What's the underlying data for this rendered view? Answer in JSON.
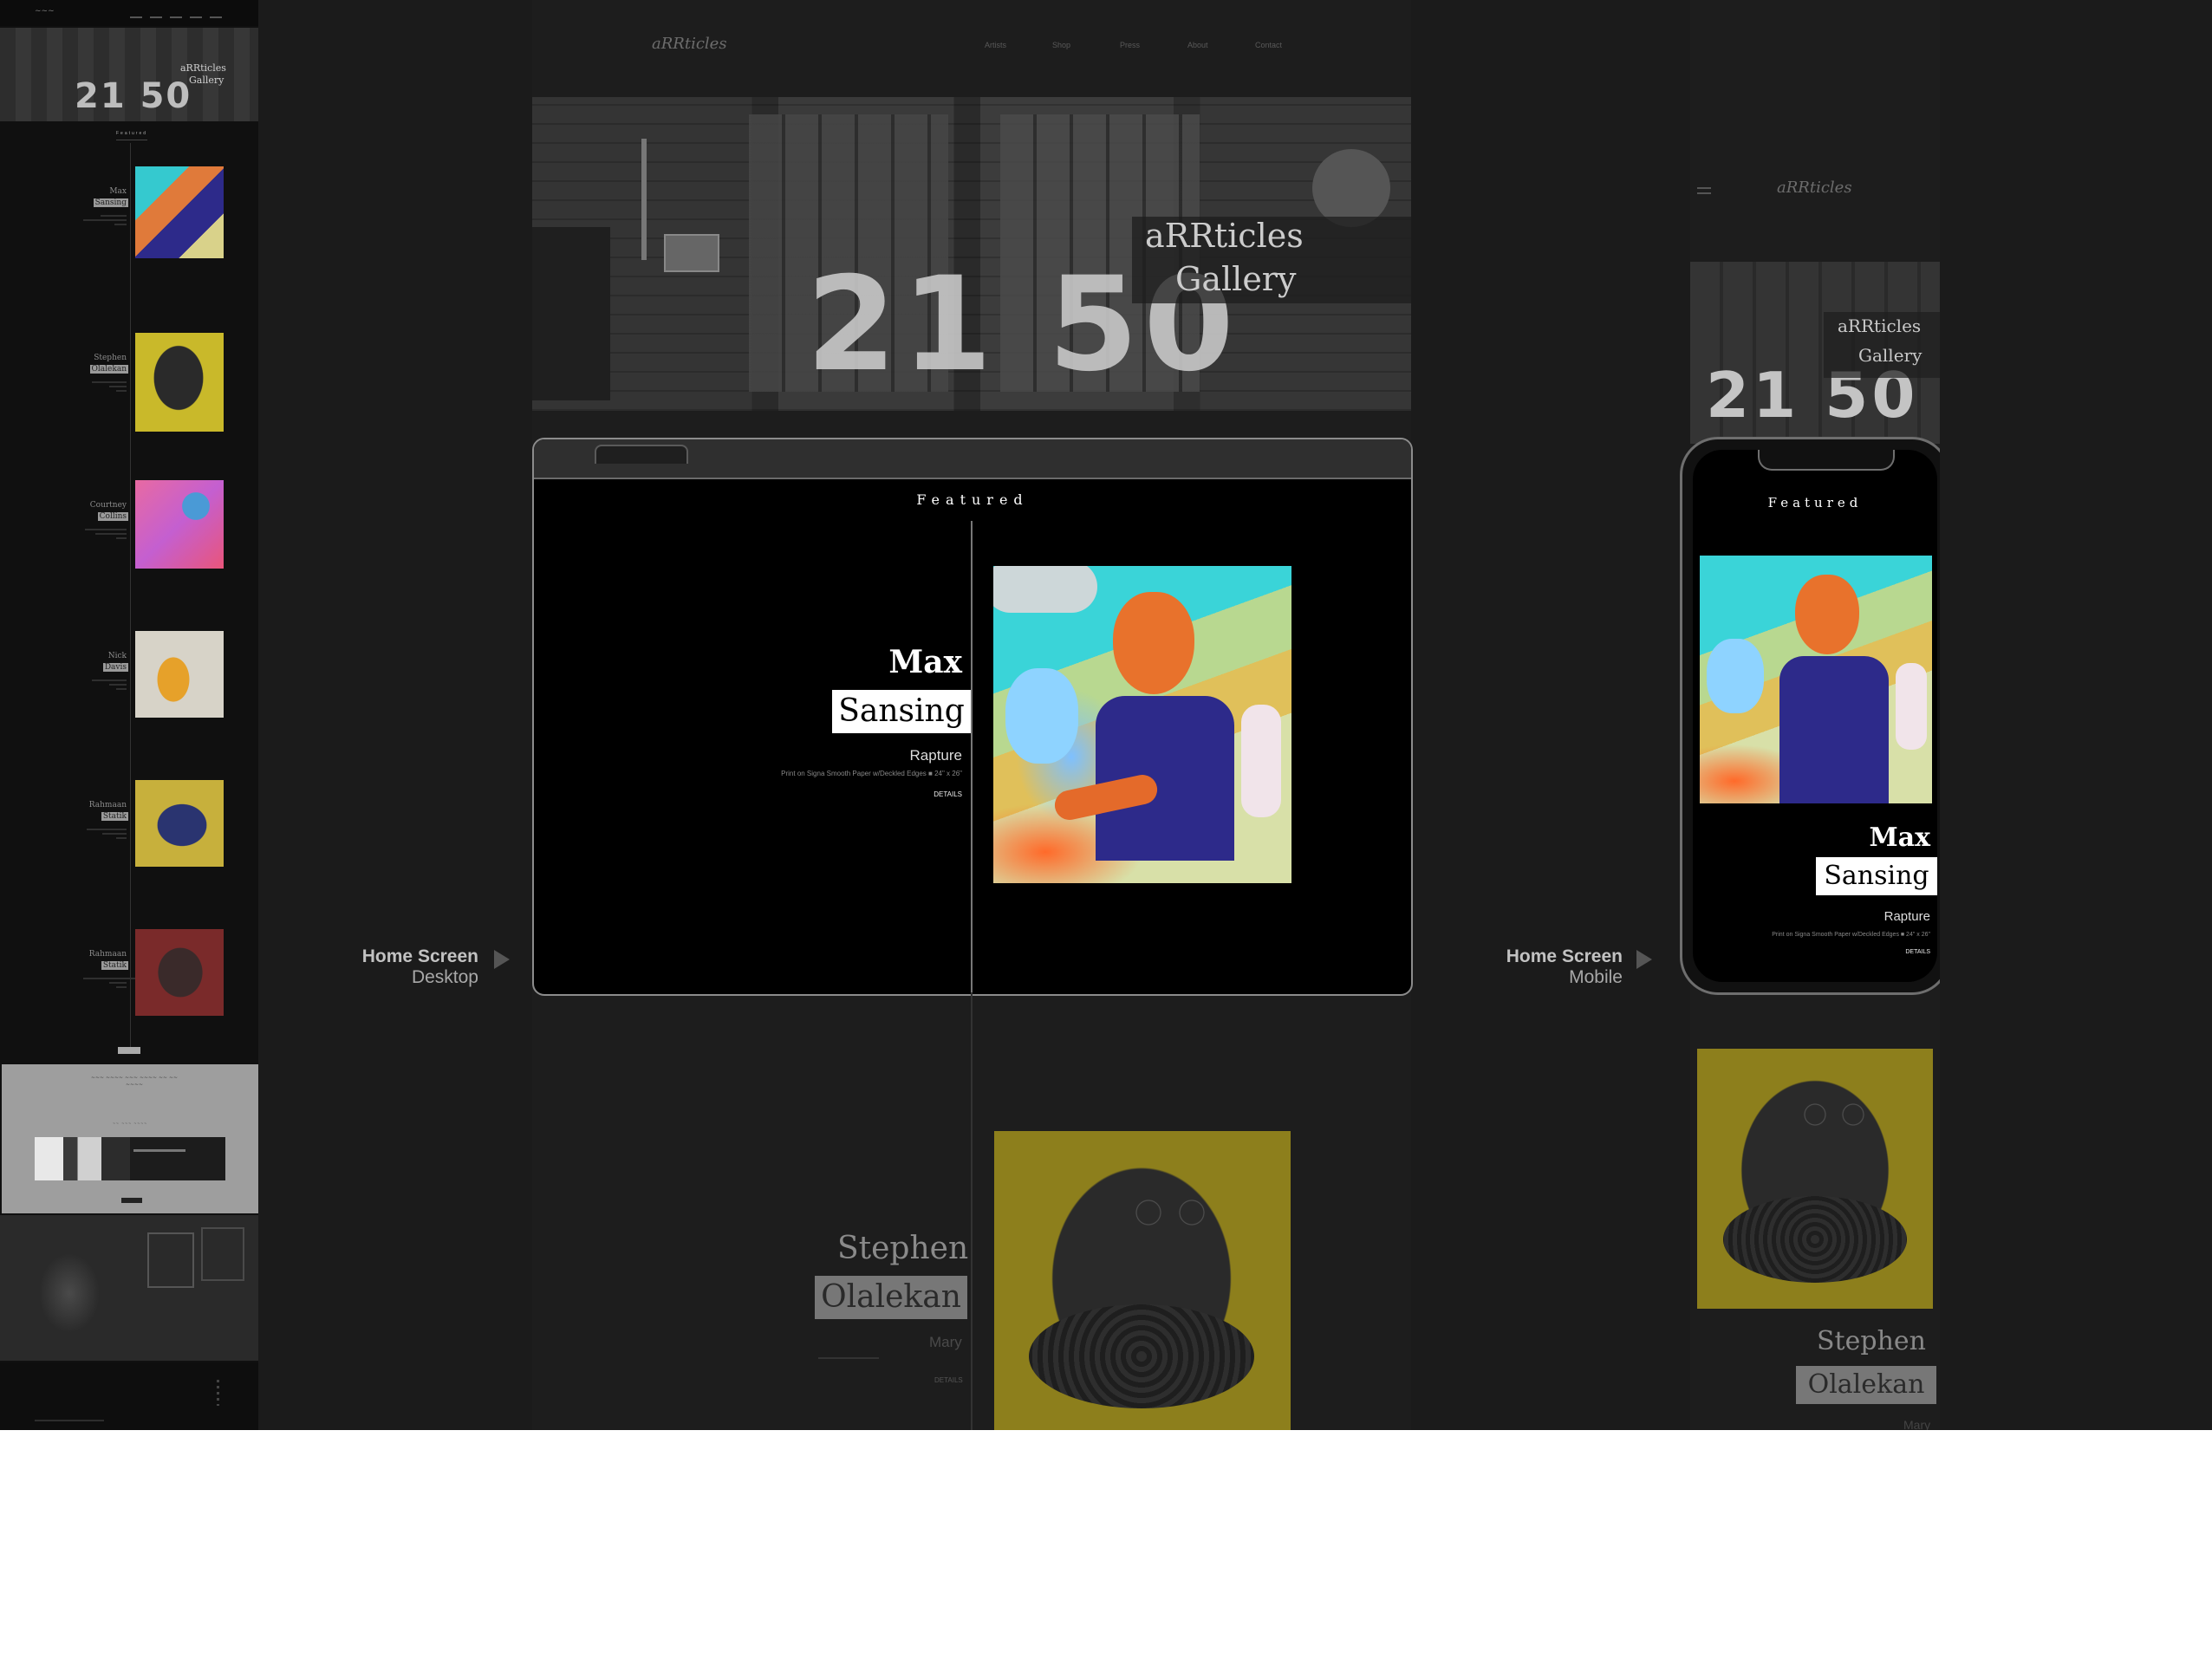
{
  "desktop": {
    "logo": "aRRticles",
    "nav": [
      "Artists",
      "Shop",
      "Press",
      "About",
      "Contact"
    ],
    "hero": {
      "line1": "aRRticles",
      "line2": "Gallery",
      "number": "21 50"
    },
    "featured_label": "Featured",
    "featured": {
      "first_name": "Max",
      "last_name": "Sansing",
      "title": "Rapture",
      "description": "Print on Signa Smooth Paper w/Deckled Edges ■ 24\" x 26\"",
      "details_label": "DETAILS"
    },
    "next": {
      "first_name": "Stephen",
      "last_name": "Olalekan",
      "title": "Mary",
      "details_label": "DETAILS"
    },
    "label": {
      "main": "Home Screen",
      "sub": "Desktop"
    }
  },
  "mobile": {
    "logo": "aRRticles",
    "hero": {
      "line1": "aRRticles",
      "line2": "Gallery",
      "number": "21 50"
    },
    "featured_label": "Featured",
    "featured": {
      "first_name": "Max",
      "last_name": "Sansing",
      "title": "Rapture",
      "description": "Print on Signa Smooth Paper w/Deckled Edges ■ 24\" x 26\"",
      "details_label": "DETAILS"
    },
    "next": {
      "first_name": "Stephen",
      "last_name": "Olalekan",
      "title": "Mary"
    },
    "label": {
      "main": "Home Screen",
      "sub": "Mobile"
    }
  },
  "fullpage": {
    "hero": {
      "line1": "aRRticles",
      "line2": "Gallery",
      "number": "21 50"
    },
    "featured_label": "Featured",
    "artists": [
      {
        "first": "Max",
        "last": "Sansing",
        "art": "colorful"
      },
      {
        "first": "Stephen",
        "last": "Olalekan",
        "art": "sculpture-yellow"
      },
      {
        "first": "Courtney",
        "last": "Collins",
        "art": "pink-abstract"
      },
      {
        "first": "Nick",
        "last": "Davis",
        "art": "orange-figure"
      },
      {
        "first": "Rahmaan",
        "last": "Statik",
        "art": "blue-sculpture"
      },
      {
        "first": "Rahmaan",
        "last": "Statik",
        "art": "red-sculpture"
      }
    ]
  },
  "colors": {
    "canvas": "#1b1b1b",
    "screen": "#000000",
    "frame": "#8c8c8c",
    "highlight": "#ffffff"
  }
}
